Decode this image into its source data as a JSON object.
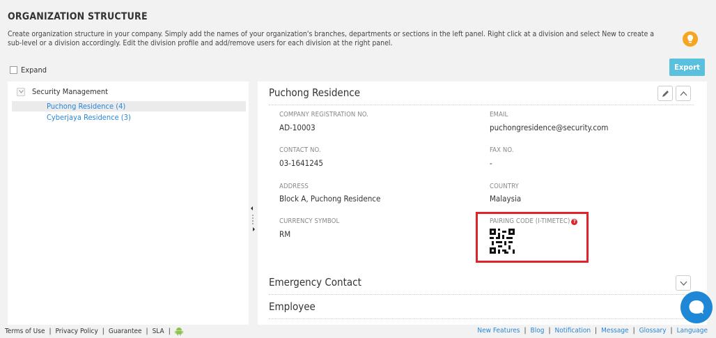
{
  "header": {
    "title": "ORGANIZATION STRUCTURE",
    "description": "Create organization structure in your company. Simply add the names of your organization's branches, departments or sections in the left panel. Right click at a division and select New to create a sub-level or a division accordingly. Edit the division profile and add/remove users for each division at the right panel."
  },
  "toolbar": {
    "expand_label": "Expand",
    "export_label": "Export"
  },
  "tree": {
    "root": "Security Management",
    "children": [
      {
        "label": "Puchong Residence (4)",
        "selected": true
      },
      {
        "label": "Cyberjaya Residence (3)",
        "selected": false
      }
    ]
  },
  "detail": {
    "title": "Puchong Residence",
    "fields": {
      "company_reg_label": "COMPANY REGISTRATION NO.",
      "company_reg_value": "AD-10003",
      "email_label": "EMAIL",
      "email_value": "puchongresidence@security.com",
      "contact_label": "CONTACT NO.",
      "contact_value": "03-1641245",
      "fax_label": "FAX NO.",
      "fax_value": "-",
      "address_label": "ADDRESS",
      "address_value": "Block A, Puchong Residence",
      "country_label": "COUNTRY",
      "country_value": "Malaysia",
      "currency_label": "CURRENCY SYMBOL",
      "currency_value": "RM",
      "pairing_label": "PAIRING CODE (I-TIMETEC)"
    },
    "sections": [
      "Emergency Contact",
      "Employee"
    ]
  },
  "footer": {
    "left_links": [
      "Terms of Use",
      "Privacy Policy",
      "Guarantee",
      "SLA"
    ],
    "right_links": [
      "New Features",
      "Blog",
      "Notification",
      "Message",
      "Glossary",
      "Language"
    ]
  },
  "colors": {
    "accent": "#5bc0de",
    "link": "#2a86d6",
    "highlight": "#e0222b",
    "chat": "#1e88d6"
  }
}
